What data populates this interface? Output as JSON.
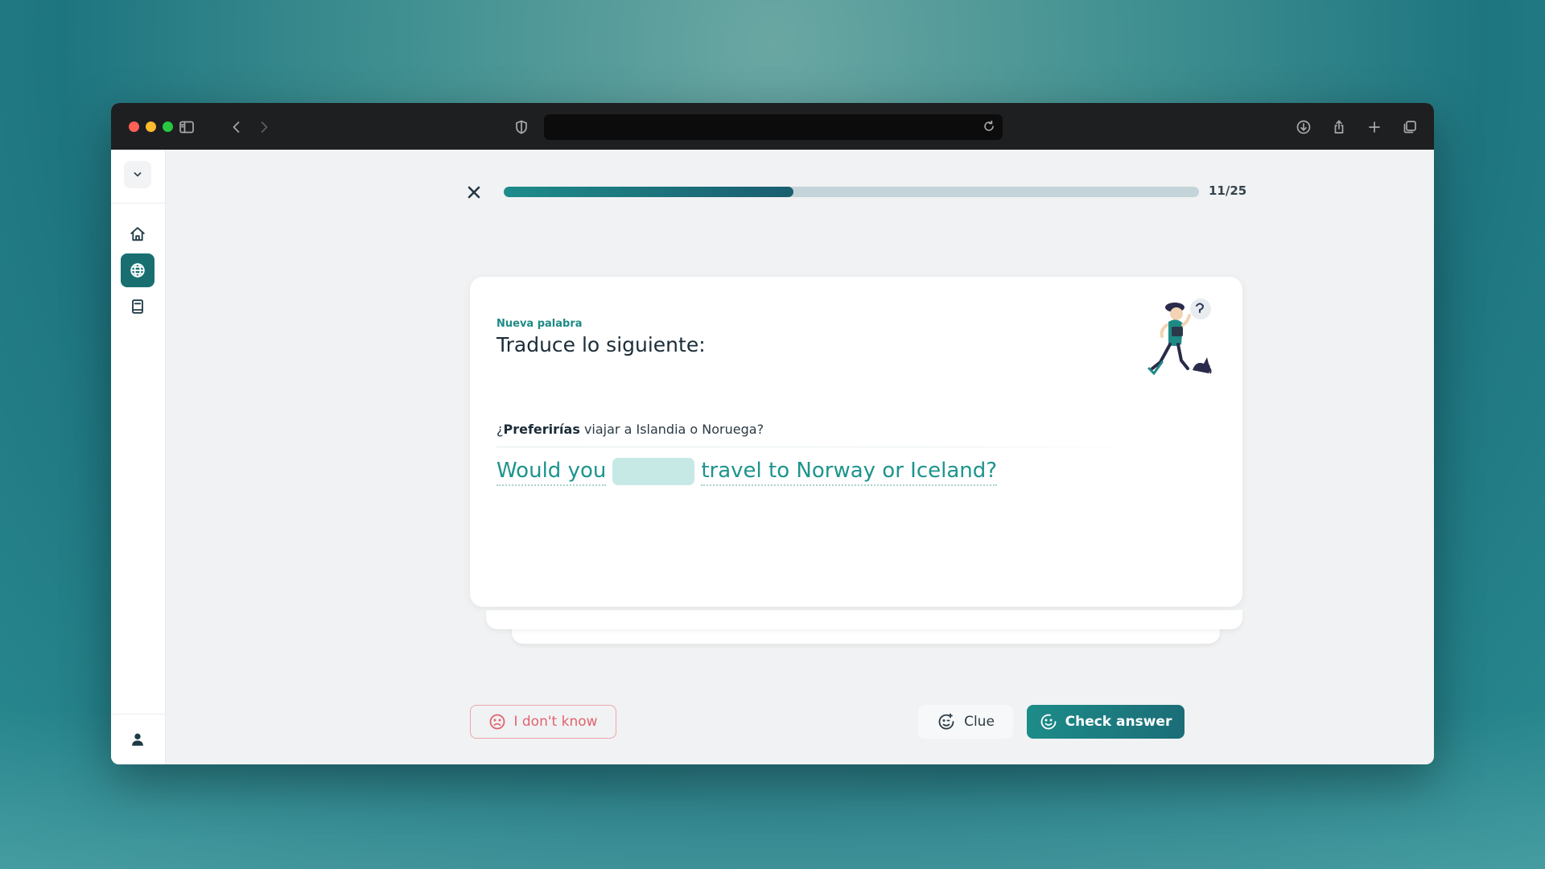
{
  "browser": {
    "toolbar_icons": [
      "sidebar-toggle-icon",
      "back-icon",
      "forward-icon",
      "privacy-shield-icon",
      "reload-icon",
      "download-icon",
      "share-icon",
      "new-tab-icon",
      "tabs-overview-icon"
    ],
    "address_value": ""
  },
  "sidebar": {
    "items": [
      {
        "icon": "home-icon"
      },
      {
        "icon": "globe-icon",
        "active": true
      },
      {
        "icon": "book-icon"
      }
    ],
    "bottom_icon": "user-icon"
  },
  "lesson": {
    "progress_count": "11/25",
    "progress_fraction": 0.4166,
    "eyebrow": "Nueva palabra",
    "title": "Traduce lo siguiente:",
    "source_prefix": "¿",
    "source_highlight": "Preferirías",
    "source_rest": " viajar a Islandia o Noruega?",
    "target_before": "Would you",
    "target_after": "travel to Norway or Iceland?"
  },
  "actions": {
    "dont_know_label": "I don't know",
    "clue_label": "Clue",
    "check_label": "Check answer"
  },
  "colors": {
    "accent": "#196f70",
    "teal_text": "#1d948d",
    "danger": "#e0636e",
    "progress_track": "#c3d5d8"
  }
}
